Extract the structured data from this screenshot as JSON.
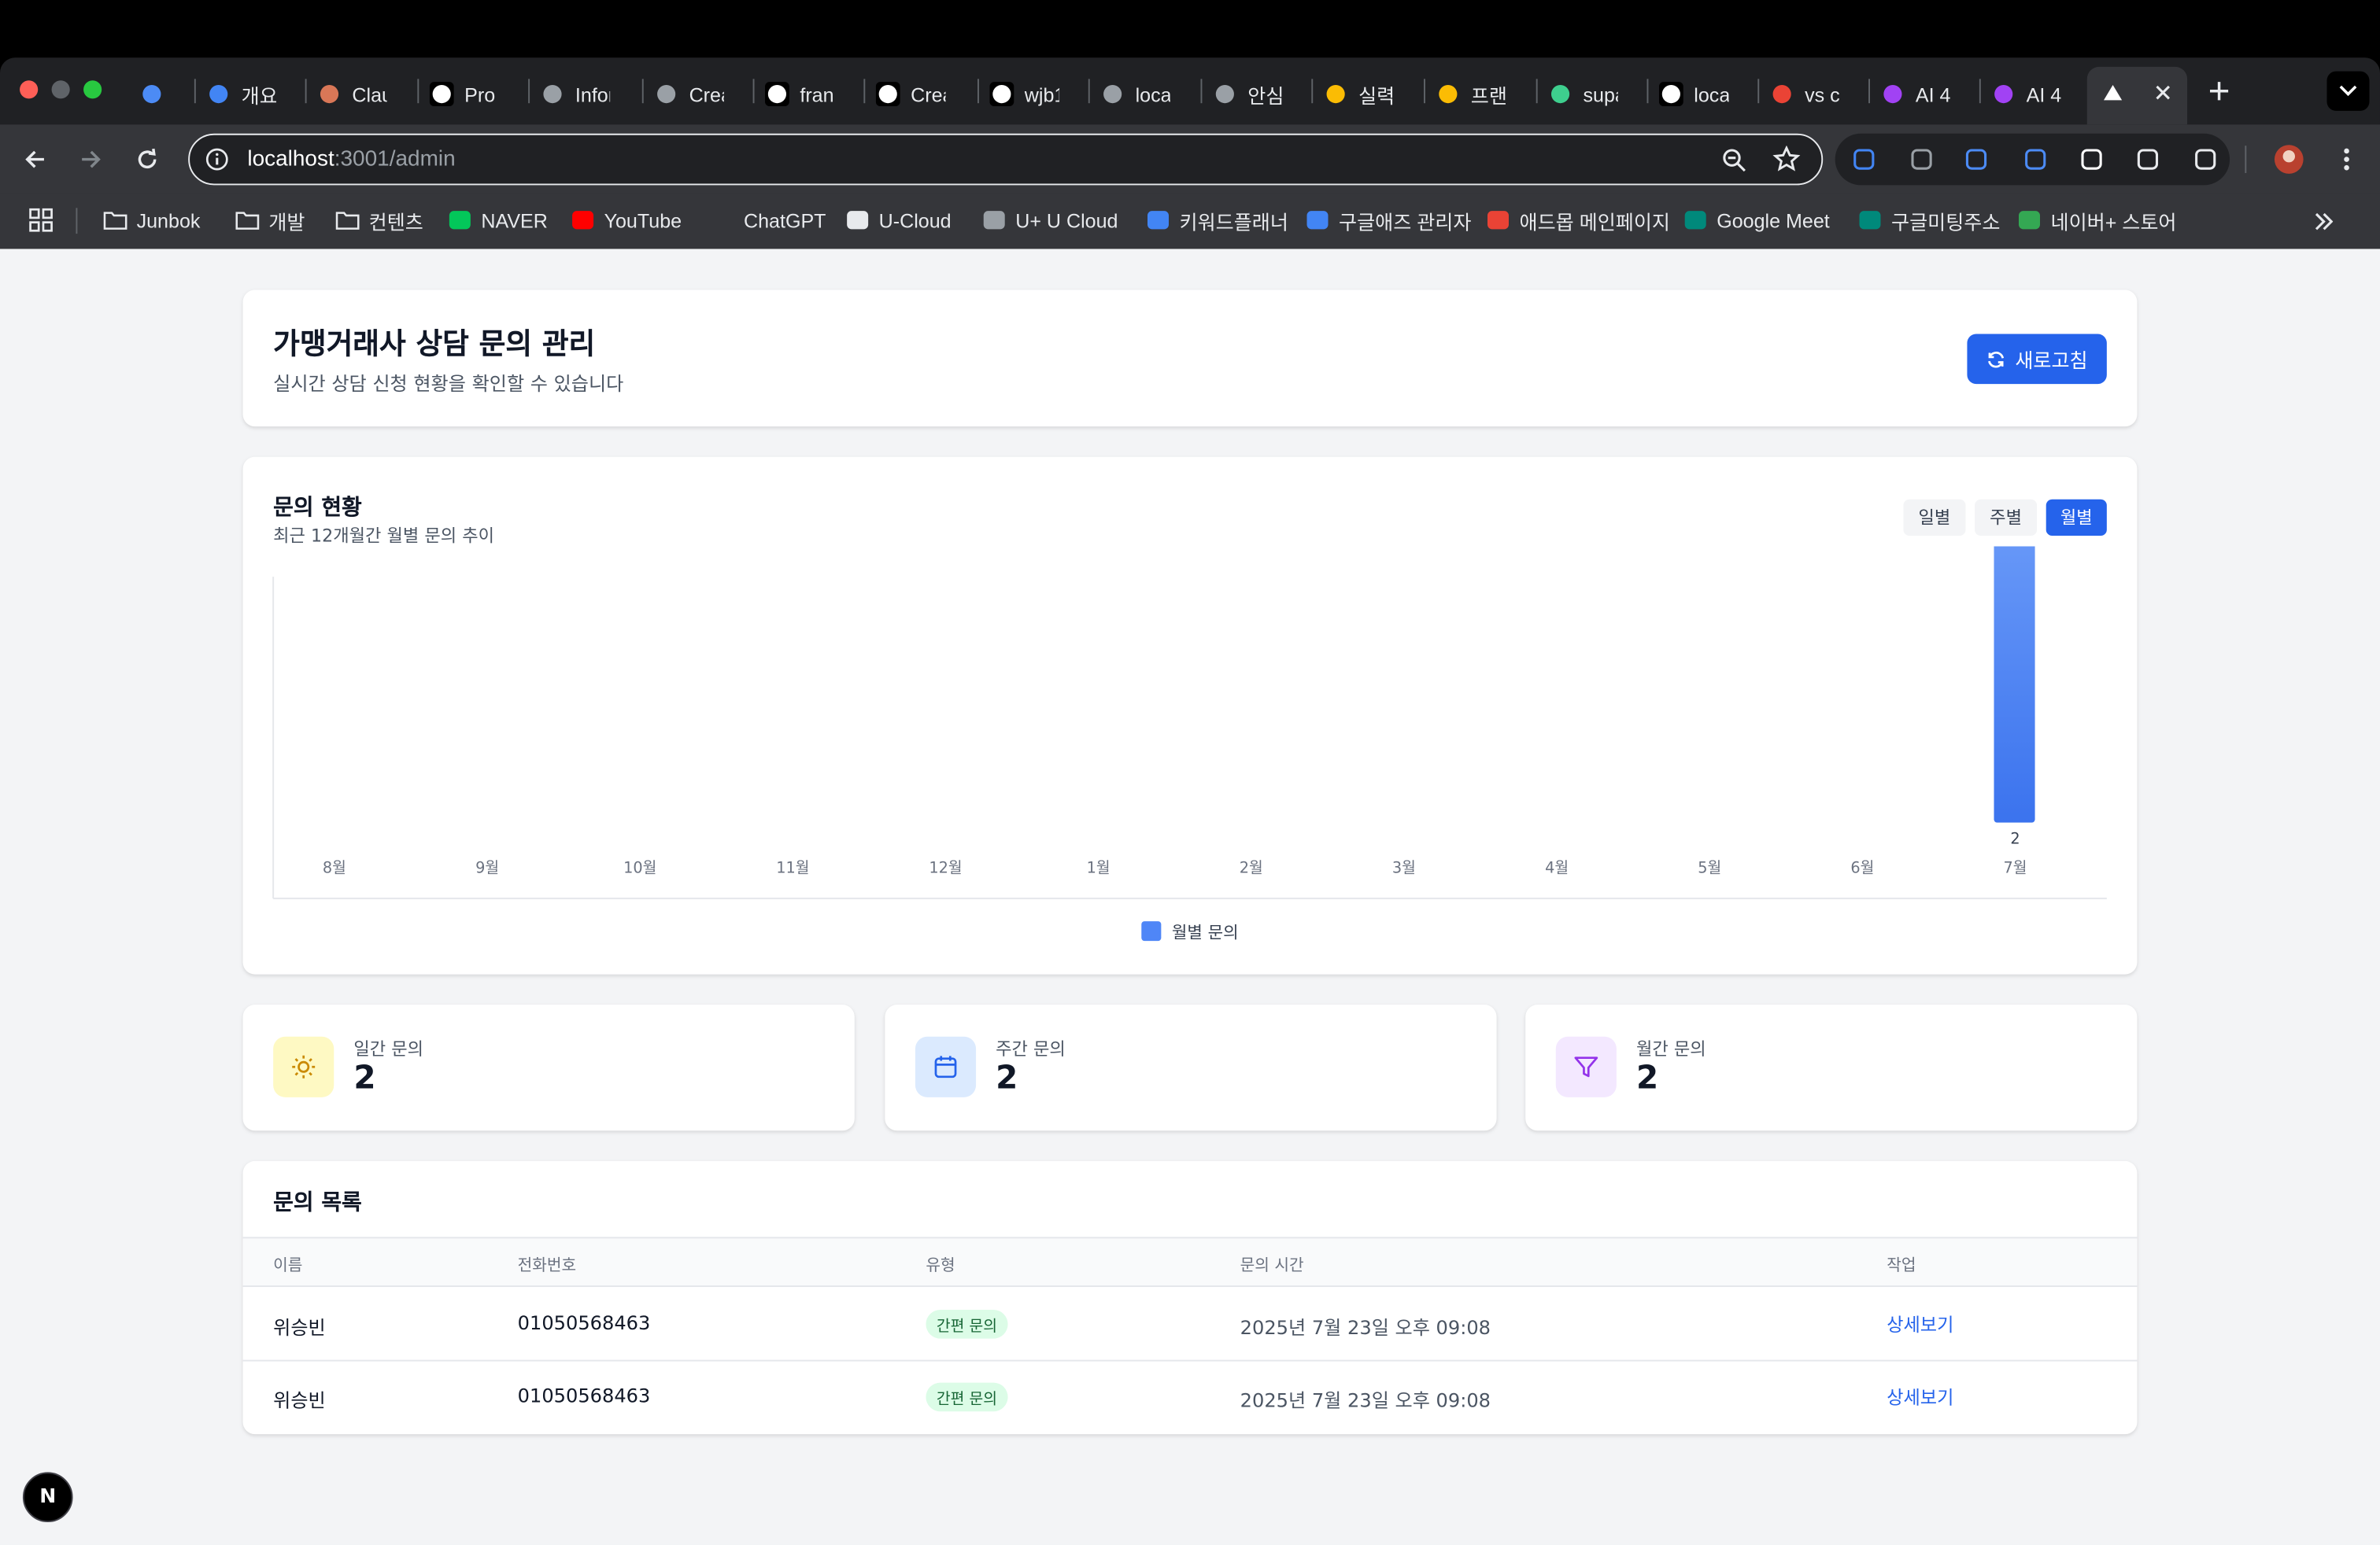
{
  "browser": {
    "tabs": [
      {
        "label": "",
        "icon": "gem-icon",
        "color": "#4c8bf5"
      },
      {
        "label": "개요",
        "icon": "google-ads-icon",
        "color": "#4285f4"
      },
      {
        "label": "Clau",
        "icon": "claude-icon",
        "color": "#d97757"
      },
      {
        "label": "Pro",
        "icon": "anthropic-icon",
        "color": "#ffffff"
      },
      {
        "label": "Infor",
        "icon": "openai-icon",
        "color": "#9aa0a6"
      },
      {
        "label": "Crea",
        "icon": "document-icon",
        "color": "#9aa0a6"
      },
      {
        "label": "fran",
        "icon": "vercel-icon",
        "color": "#ffffff"
      },
      {
        "label": "Crea",
        "icon": "vercel-icon",
        "color": "#ffffff"
      },
      {
        "label": "wjb1",
        "icon": "github-icon",
        "color": "#ffffff"
      },
      {
        "label": "loca",
        "icon": "f-icon",
        "color": "#9aa0a6"
      },
      {
        "label": "안심",
        "icon": "globe-icon",
        "color": "#9aa0a6"
      },
      {
        "label": "실력",
        "icon": "smile-icon",
        "color": "#fbbc04"
      },
      {
        "label": "프랜",
        "icon": "smile-icon",
        "color": "#fbbc04"
      },
      {
        "label": "supa",
        "icon": "supabase-icon",
        "color": "#3ecf8e"
      },
      {
        "label": "loca",
        "icon": "vercel-icon",
        "color": "#ffffff"
      },
      {
        "label": "vs c",
        "icon": "google-icon",
        "color": "#ea4335"
      },
      {
        "label": "AI 4",
        "icon": "grid-app-icon",
        "color": "#a142f4"
      },
      {
        "label": "AI 4",
        "icon": "grid-app-icon",
        "color": "#a142f4"
      }
    ],
    "url_host": "localhost",
    "url_rest": ":3001/admin",
    "bookmarks": [
      "Junbok",
      "개발",
      "컨텐츠",
      "NAVER",
      "YouTube",
      "ChatGPT",
      "U-Cloud",
      "U+ U Cloud",
      "키워드플래너",
      "구글애즈 관리자",
      "애드몹 메인페이지",
      "Google Meet",
      "구글미팅주소",
      "네이버+ 스토어"
    ]
  },
  "header": {
    "title": "가맹거래사 상담 문의 관리",
    "subtitle": "실시간 상담 신청 현황을 확인할 수 있습니다",
    "refresh_label": "새로고침"
  },
  "chart_section": {
    "title": "문의 현황",
    "subtitle": "최근 12개월간 월별 문의 추이",
    "tabs": [
      "일별",
      "주별",
      "월별"
    ],
    "active_tab": "월별"
  },
  "chart_data": {
    "type": "bar",
    "categories": [
      "8월",
      "9월",
      "10월",
      "11월",
      "12월",
      "1월",
      "2월",
      "3월",
      "4월",
      "5월",
      "6월",
      "7월"
    ],
    "series": [
      {
        "name": "월별 문의",
        "values": [
          0,
          0,
          0,
          0,
          0,
          0,
          0,
          0,
          0,
          0,
          0,
          2
        ]
      }
    ],
    "ylim": [
      0,
      2
    ],
    "grid": false,
    "legend": "bottom-center",
    "bar_color": "#4f86f7",
    "value_labels": [
      "",
      "",
      "",
      "",
      "",
      "",
      "",
      "",
      "",
      "",
      "",
      "2"
    ]
  },
  "stats": [
    {
      "label": "일간 문의",
      "value": "2",
      "icon": "sun-icon",
      "bg": "#fef9c3",
      "fg": "#ca8a04"
    },
    {
      "label": "주간 문의",
      "value": "2",
      "icon": "calendar-icon",
      "bg": "#dbeafe",
      "fg": "#2563eb"
    },
    {
      "label": "월간 문의",
      "value": "2",
      "icon": "filter-icon",
      "bg": "#f3e8ff",
      "fg": "#9333ea"
    }
  ],
  "table": {
    "title": "문의 목록",
    "columns": [
      "이름",
      "전화번호",
      "유형",
      "문의 시간",
      "작업"
    ],
    "rows": [
      {
        "name": "위승빈",
        "phone": "01050568463",
        "type": "간편 문의",
        "time": "2025년 7월 23일 오후 09:08",
        "action": "상세보기"
      },
      {
        "name": "위승빈",
        "phone": "01050568463",
        "type": "간편 문의",
        "time": "2025년 7월 23일 오후 09:08",
        "action": "상세보기"
      }
    ]
  },
  "dev_badge": "N"
}
